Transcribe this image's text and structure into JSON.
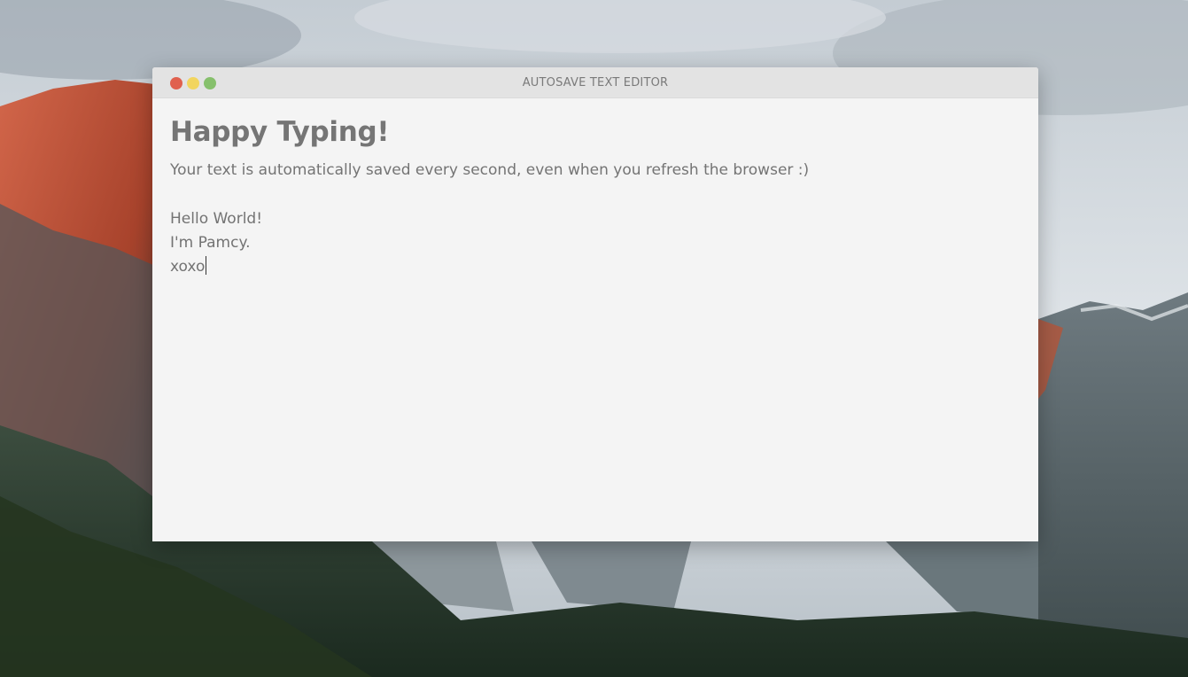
{
  "window": {
    "title": "AUTOSAVE TEXT EDITOR",
    "controls": [
      {
        "name": "close",
        "color": "#e0604e"
      },
      {
        "name": "minimize",
        "color": "#f2d55e"
      },
      {
        "name": "maximize",
        "color": "#86c06c"
      }
    ]
  },
  "content": {
    "heading": "Happy Typing!",
    "subtitle": "Your text is automatically saved every second, even when you refresh the browser :)",
    "editor_lines": [
      "Hello World!",
      "I'm Pamcy.",
      "xoxo"
    ]
  },
  "wallpaper": {
    "description_icon": "mountain-landscape-wallpaper"
  }
}
